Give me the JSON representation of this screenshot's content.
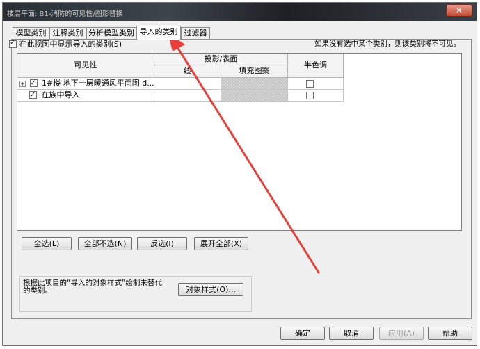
{
  "window": {
    "title": "楼层平面: B1-消防的可见性/图形替换",
    "close_glyph": "✕"
  },
  "tabs": [
    {
      "label": "模型类别",
      "active": false
    },
    {
      "label": "注释类别",
      "active": false
    },
    {
      "label": "分析模型类别",
      "active": false
    },
    {
      "label": "导入的类别",
      "active": true
    },
    {
      "label": "过滤器",
      "active": false
    }
  ],
  "show_imported": {
    "label": "在此视图中显示导入的类别(S)",
    "checked": true
  },
  "hint": "如果没有选中某个类别，则该类别将不可见。",
  "table": {
    "headers": {
      "visibility": "可见性",
      "projection_surface": "投影/表面",
      "lines": "线",
      "fill_pattern": "填充图案",
      "halftone": "半色调"
    },
    "rows": [
      {
        "expander": "+",
        "checked": true,
        "name": "1#楼 地下一层暖通风平面图.d...",
        "halftone": false
      },
      {
        "expander": "",
        "checked": true,
        "name": "在族中导入",
        "halftone": false
      }
    ]
  },
  "buttons": {
    "select_all": "全选(L)",
    "select_none": "全部不选(N)",
    "invert": "反选(I)",
    "expand_all": "展开全部(X)"
  },
  "object_styles": {
    "note": "根据此项目的“导入的对象样式”绘制未替代的类别。",
    "button": "对象样式(O)..."
  },
  "footer": {
    "ok": "确定",
    "cancel": "取消",
    "apply": "应用(A)",
    "help": "帮助"
  },
  "colors": {
    "arrow": "#e8413c",
    "titlebar": "#2a2f36",
    "close_button": "#c24a31"
  },
  "icons": [
    "close-icon",
    "expand-icon",
    "checkbox-icon",
    "annotation-arrow"
  ]
}
